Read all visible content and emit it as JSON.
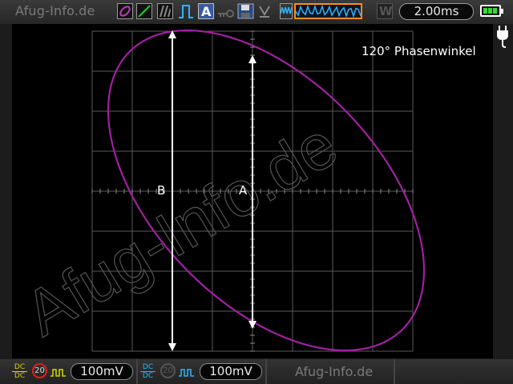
{
  "toolbar": {
    "brand": "Afug-Info.de",
    "timebase": "2.00ms",
    "icons": [
      "xy-mode-icon",
      "line-icon",
      "hatch-icon",
      "pulse-icon",
      "auto-icon",
      "key-icon",
      "save-icon",
      "waveform-icon",
      "w-icon",
      "battery-icon",
      "plug-icon"
    ],
    "auto_letter": "A",
    "w_letter": "W"
  },
  "screen": {
    "annotation": "120° Phasenwinkel",
    "marker_b": "B",
    "marker_a": "A",
    "watermark": "Afug-Info.de",
    "trace_color": "#a020a0",
    "grid_color": "#5a5a5a"
  },
  "channels": [
    {
      "coupling_top": "DC",
      "coupling_bottom": "DC",
      "bw_limit": "20",
      "scale": "100mV",
      "color": "#d6d600"
    },
    {
      "coupling_top": "DC",
      "coupling_bottom": "DC",
      "bw_limit": "20",
      "scale": "100mV",
      "color": "#2fb4ff"
    }
  ],
  "footer": {
    "brand": "Afug-Info.de"
  }
}
